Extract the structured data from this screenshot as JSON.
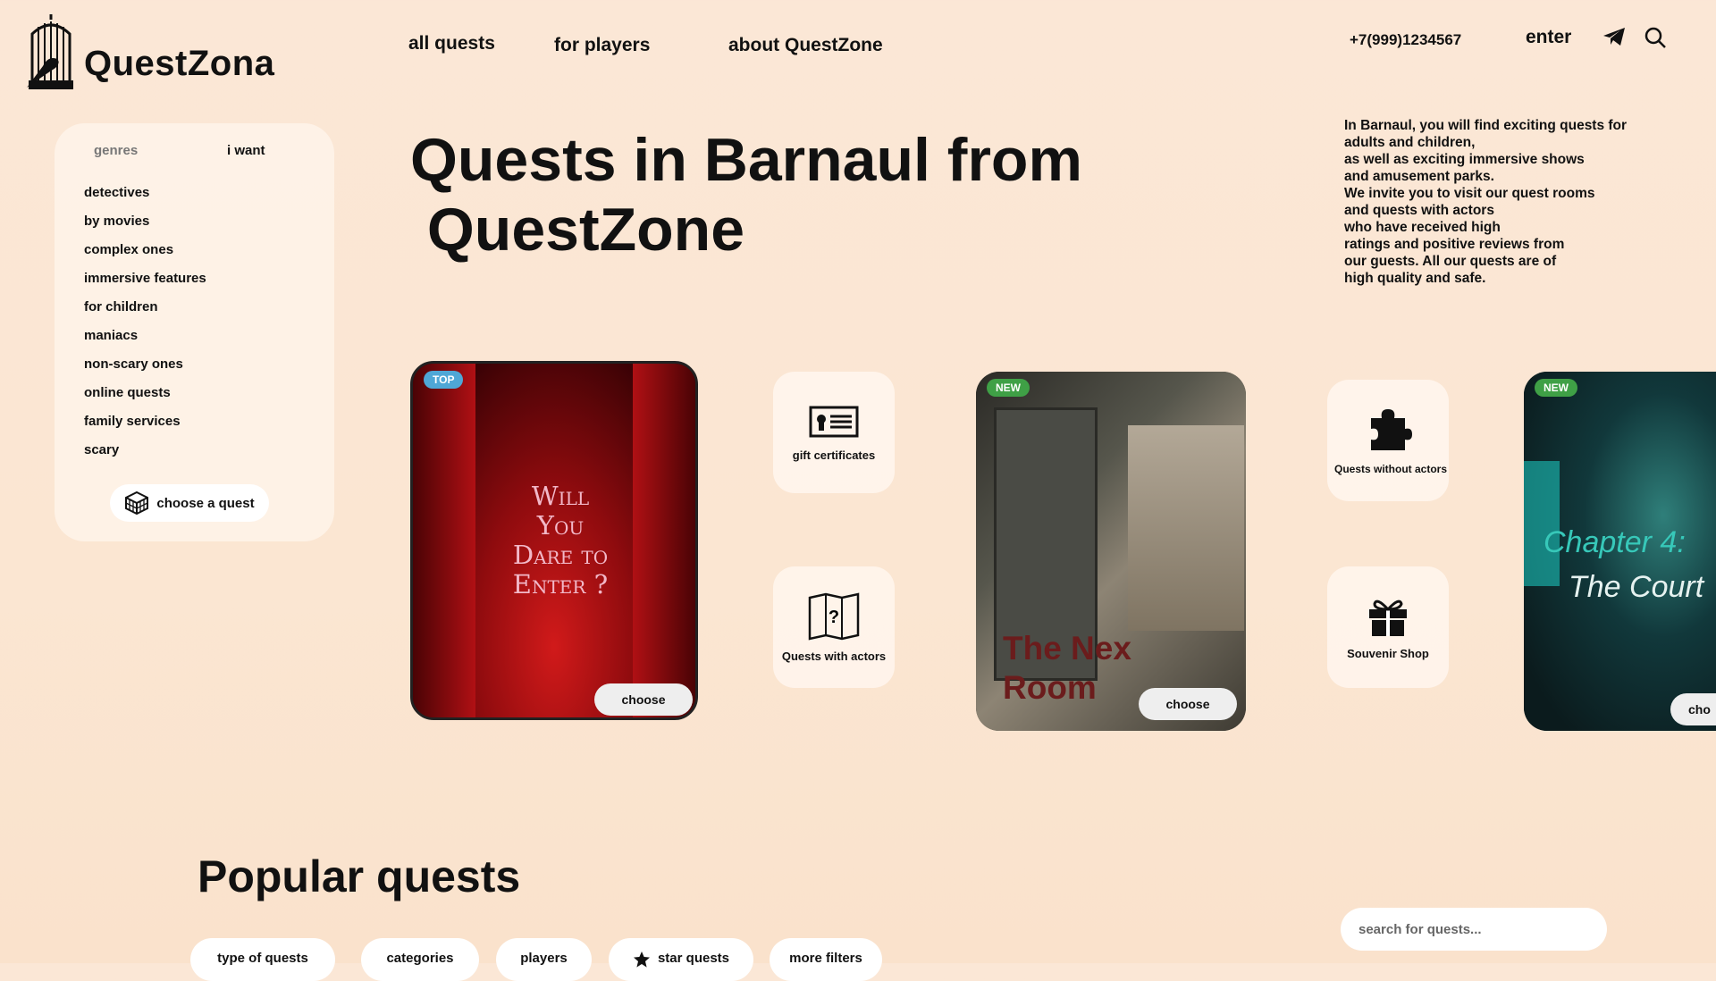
{
  "brand": {
    "name": "QuestZona"
  },
  "nav": {
    "all_quests": "all quests",
    "for_players": "for players",
    "about": "about QuestZone"
  },
  "header": {
    "phone": "+7(999)1234567",
    "enter": "enter"
  },
  "sidebar": {
    "tab_genres": "genres",
    "tab_i_want": "i want",
    "items": [
      "detectives",
      "by movies",
      "complex ones",
      "immersive features",
      "for children",
      "maniacs",
      "non-scary ones",
      "online quests",
      "family services",
      "scary"
    ],
    "choose_label": "choose a quest"
  },
  "hero": {
    "title_line1": "Quests in Barnaul from",
    "title_line2": " QuestZone",
    "description": "In Barnaul, you will find exciting quests for\n adults and children,\n as well as exciting immersive shows\nand amusement parks.\nWe invite you to visit our quest rooms\nand quests with actors\n who have received high\n ratings and positive reviews from\nour guests. All our quests are of\n high quality and safe."
  },
  "cards": [
    {
      "badge": "TOP",
      "image_text": "Will\nYou\nDare to\nEnter ?",
      "button": "choose"
    },
    {
      "badge": "NEW",
      "image_text": "The Nex\nRoom",
      "button": "choose"
    },
    {
      "badge": "NEW",
      "image_text_1": "Chapter 4:",
      "image_text_2": "The Court",
      "button": "cho"
    }
  ],
  "tiles": {
    "gift": "gift certificates",
    "with_actors": "Quests with actors",
    "without_actors": "Quests without actors",
    "souvenir": "Souvenir Shop"
  },
  "popular": {
    "title": "Popular quests",
    "search_placeholder": "search for quests...",
    "filters": [
      "type of quests",
      "categories",
      "players",
      "star quests",
      "more filters"
    ]
  },
  "colors": {
    "background": "#fbe7d6",
    "badge_top": "#4fa7d6",
    "badge_new": "#3fa046"
  }
}
